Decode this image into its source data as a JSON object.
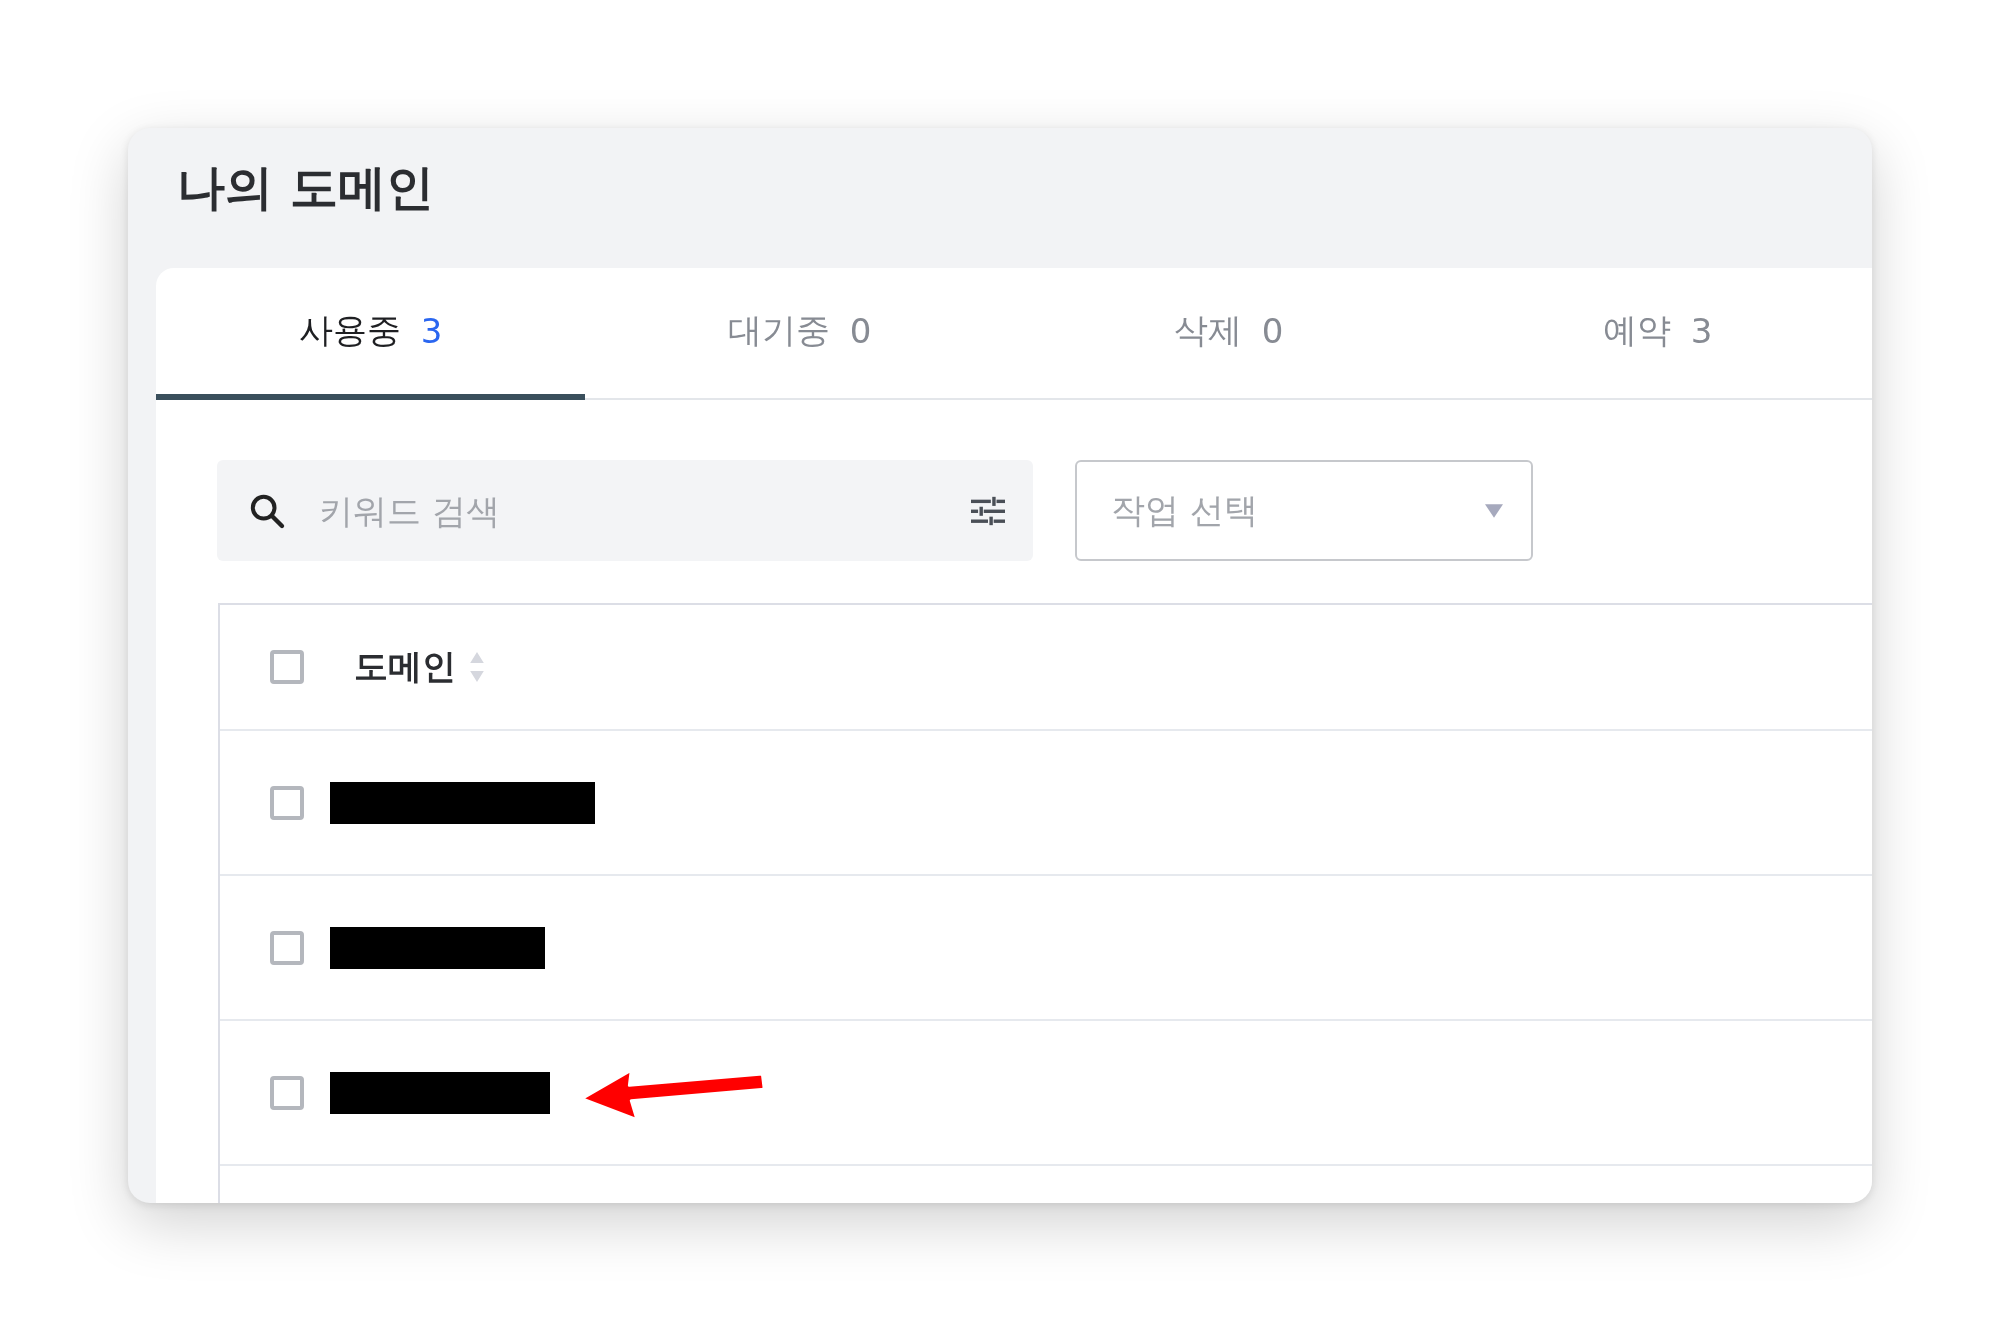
{
  "page_title": "나의 도메인",
  "tabs": [
    {
      "label": "사용중",
      "count": "3",
      "selected": true
    },
    {
      "label": "대기중",
      "count": "0",
      "selected": false
    },
    {
      "label": "삭제",
      "count": "0",
      "selected": false
    },
    {
      "label": "예약",
      "count": "3",
      "selected": false
    }
  ],
  "search": {
    "placeholder": "키워드 검색"
  },
  "action_select": {
    "placeholder": "작업 선택"
  },
  "table": {
    "columns": [
      {
        "label": "도메인",
        "sortable": true
      }
    ],
    "all_checked": false,
    "rows": [
      {
        "kind": "redacted",
        "checked": false,
        "marked": false
      },
      {
        "kind": "redacted",
        "checked": false,
        "marked": false
      },
      {
        "kind": "redacted",
        "checked": false,
        "marked": true
      }
    ]
  }
}
